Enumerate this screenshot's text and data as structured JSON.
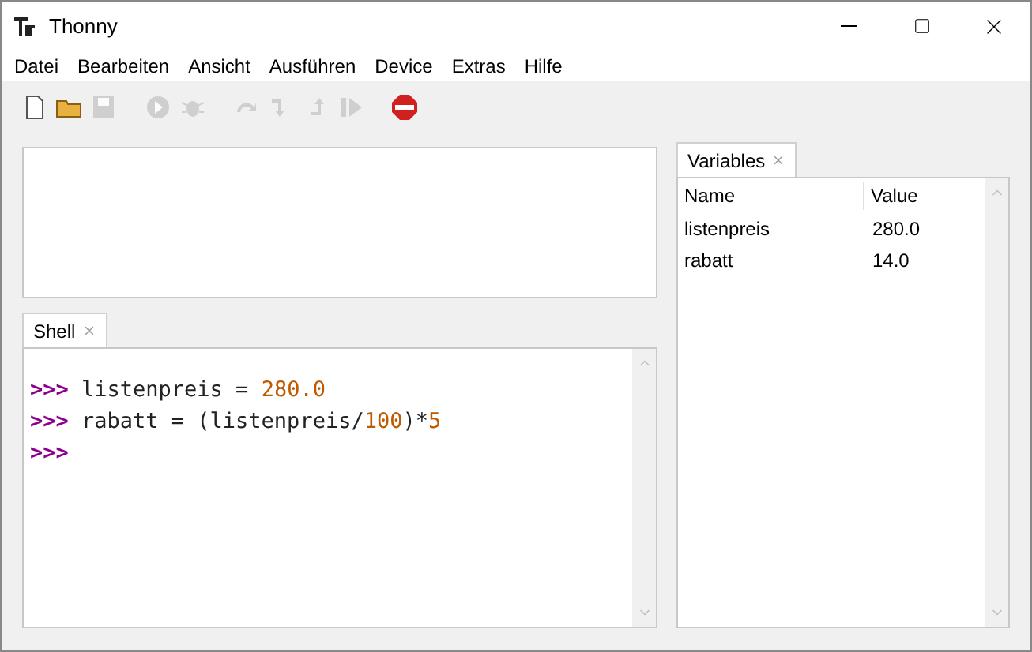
{
  "window": {
    "title": "Thonny"
  },
  "menu": [
    "Datei",
    "Bearbeiten",
    "Ansicht",
    "Ausführen",
    "Device",
    "Extras",
    "Hilfe"
  ],
  "toolbar": [
    {
      "kind": "new",
      "disabled": false
    },
    {
      "kind": "open",
      "disabled": false
    },
    {
      "kind": "save",
      "disabled": true
    },
    {
      "kind": "gap"
    },
    {
      "kind": "run",
      "disabled": true
    },
    {
      "kind": "debug",
      "disabled": true
    },
    {
      "kind": "gap"
    },
    {
      "kind": "step-over",
      "disabled": true
    },
    {
      "kind": "step-into",
      "disabled": true
    },
    {
      "kind": "step-out",
      "disabled": true
    },
    {
      "kind": "resume",
      "disabled": true
    },
    {
      "kind": "gap"
    },
    {
      "kind": "stop",
      "disabled": false
    }
  ],
  "shell": {
    "tab": "Shell",
    "lines": [
      [
        {
          "kind": "prompt",
          "text": ">>>"
        },
        {
          "kind": "code",
          "text": " listenpreis = "
        },
        {
          "kind": "number",
          "text": "280.0"
        }
      ],
      [
        {
          "kind": "prompt",
          "text": ">>>"
        },
        {
          "kind": "code",
          "text": " rabatt = (listenpreis/"
        },
        {
          "kind": "number",
          "text": "100"
        },
        {
          "kind": "code",
          "text": ")*"
        },
        {
          "kind": "number",
          "text": "5"
        }
      ],
      [
        {
          "kind": "prompt",
          "text": ">>>"
        }
      ]
    ]
  },
  "variables": {
    "tab": "Variables",
    "columns": [
      "Name",
      "Value"
    ],
    "rows": [
      {
        "name": "listenpreis",
        "value": "280.0"
      },
      {
        "name": "rabatt",
        "value": "14.0"
      }
    ]
  }
}
